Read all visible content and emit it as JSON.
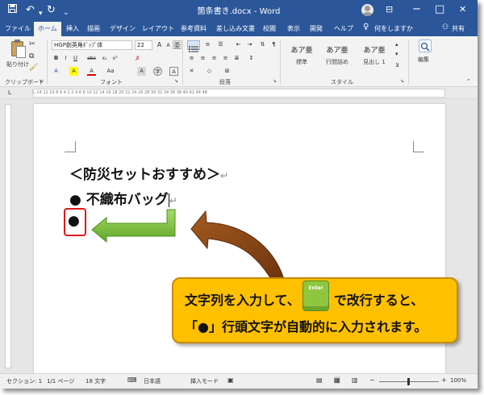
{
  "titlebar": {
    "doc_title": "箇条書き.docx  -  Word",
    "save_icon": "save-icon",
    "undo_icon": "undo-icon",
    "redo_icon": "redo-icon",
    "customize_icon": "customize-icon",
    "minimize": "−",
    "maximize": "□",
    "close": "✕"
  },
  "tabs": [
    "ファイル",
    "ホーム",
    "挿入",
    "描画",
    "デザイン",
    "レイアウト",
    "参考資料",
    "差し込み文書",
    "校閲",
    "表示",
    "開発",
    "ヘルプ"
  ],
  "tell_me": "何をしますか",
  "share": "共有",
  "ribbon": {
    "clipboard": {
      "paste": "貼り付け",
      "label": "クリップボード"
    },
    "font": {
      "name": "HGP創英角ﾎﾟｯﾌﾟ体",
      "size": "22",
      "label": "フォント",
      "row2": [
        "B",
        "I",
        "U",
        "abc",
        "x₂",
        "x²"
      ],
      "row3": [
        "A",
        "A",
        "Aa",
        "A"
      ]
    },
    "paragraph": {
      "label": "段落"
    },
    "styles": {
      "label": "スタイル",
      "items": [
        {
          "preview": "あア亜",
          "name": "標準"
        },
        {
          "preview": "あア亜",
          "name": "行間詰め"
        },
        {
          "preview": "あア亜",
          "name": "見出し 1"
        }
      ]
    },
    "editing": {
      "label": "編集"
    }
  },
  "ruler_marks": "L  14 12 10  8  6  4  2     2  4  6  8  10 12 14 16 18 20 22 24 26 28 30 32 34 36 38 40 42 44    48",
  "document": {
    "line1": "＜防災セットおすすめ＞",
    "line2": "● 不織布バッグ",
    "bullet": "●",
    "paragraph_mark": "↵"
  },
  "callout": {
    "line1_before": "文字列を入力して、",
    "line1_after": "で改行すると、",
    "line2": "「●」行頭文字が自動的に入力されます。",
    "key_label": "Enter"
  },
  "statusbar": {
    "section": "セクション: 1",
    "pages": "1/1 ページ",
    "words": "18 文字",
    "language": "日本語",
    "insert_mode": "挿入モード",
    "zoom": "100%",
    "minus": "−",
    "plus": "+"
  },
  "colors": {
    "word_blue": "#2b579a",
    "callout_yellow": "#ffc000",
    "arrow_green": "#7dc23a",
    "arrow_brown": "#8b4a16",
    "highlight_red": "#e01a1a"
  }
}
